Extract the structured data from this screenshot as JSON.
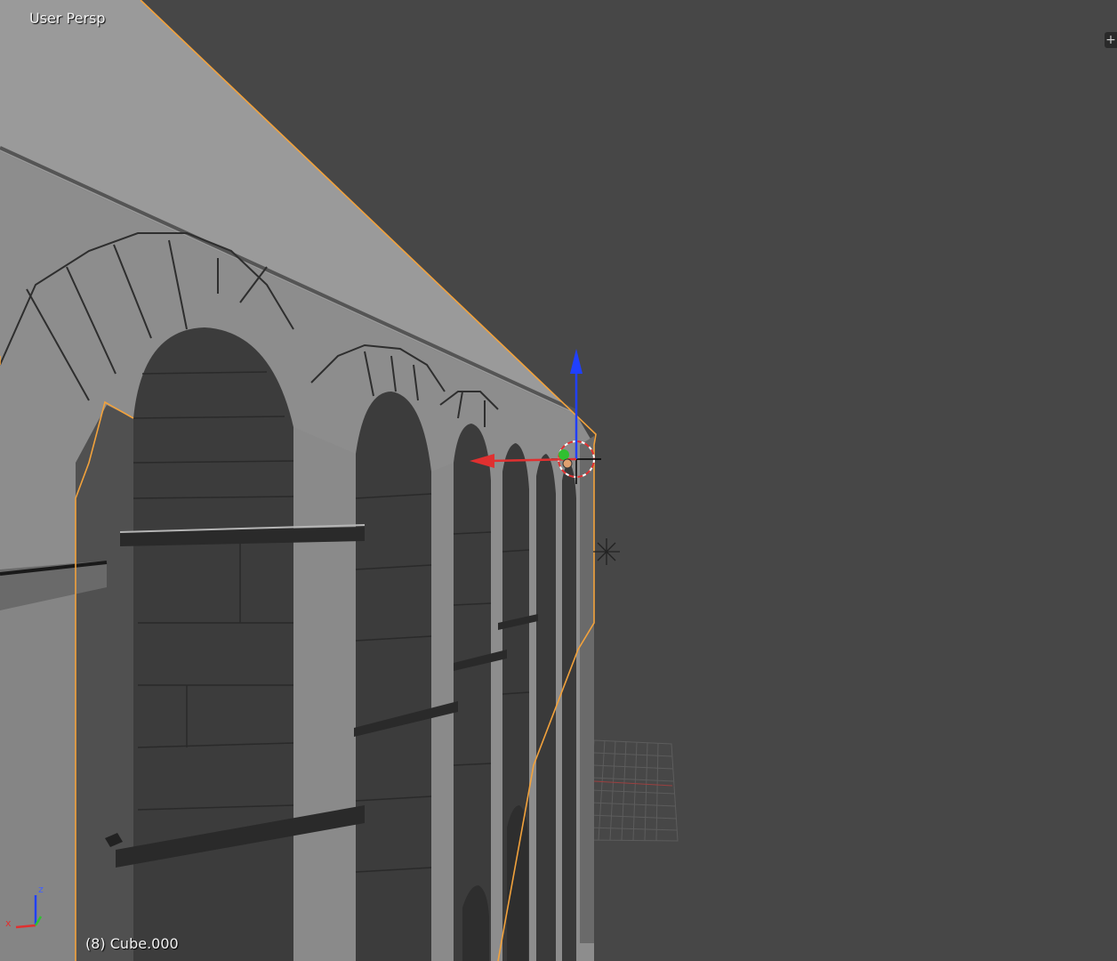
{
  "viewport": {
    "view_label": "User Persp",
    "object_info": "(8) Cube.000",
    "toolshelf_toggle_icon": "plus-icon"
  },
  "axis_widget": {
    "x_label": "x",
    "z_label": "z"
  },
  "colors": {
    "background": "#474747",
    "mesh_light": "#959595",
    "mesh_dark": "#3f3f3f",
    "selection_outline": "#f2a23c",
    "axis_x": "#e03030",
    "axis_y": "#30c030",
    "axis_z": "#2040ff"
  }
}
